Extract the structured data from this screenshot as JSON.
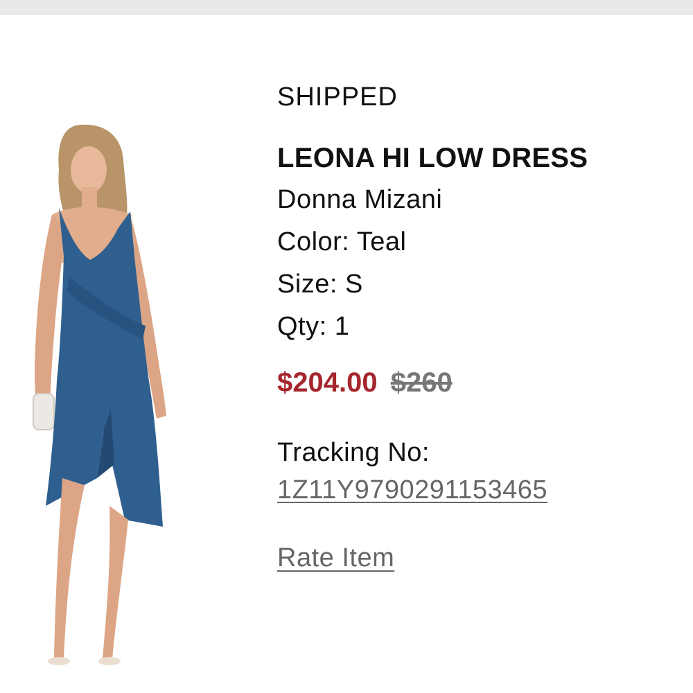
{
  "order_item": {
    "status": "SHIPPED",
    "product_name": "LEONA HI LOW DRESS",
    "brand": "Donna Mizani",
    "color_line": "Color: Teal",
    "size_line": "Size: S",
    "qty_line": "Qty: 1",
    "sale_price": "$204.00",
    "original_price": "$260",
    "tracking_label": "Tracking No:",
    "tracking_number": "1Z11Y9790291153465",
    "rate_item_label": "Rate Item"
  },
  "colors": {
    "sale_price": "#a5262c",
    "original_price": "#777777",
    "link": "#666666",
    "dress": "#2f5f8f"
  },
  "image": {
    "subject": "model-wearing-teal-wrap-dress"
  }
}
